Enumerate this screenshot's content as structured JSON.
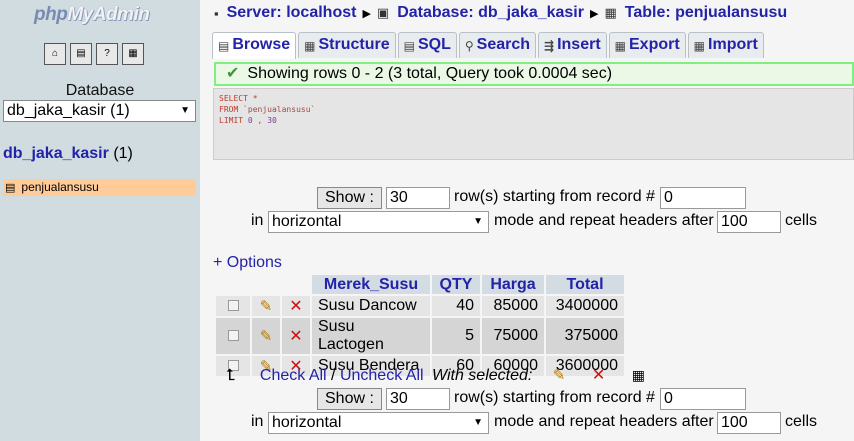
{
  "left": {
    "logo_php": "php",
    "logo_myadmin": "MyAdmin",
    "database_label": "Database",
    "database_select": "db_jaka_kasir (1)",
    "db_link": "db_jaka_kasir",
    "db_count": "(1)",
    "table_item": "penjualansusu"
  },
  "breadcrumb": {
    "server": "Server: localhost",
    "database": "Database: db_jaka_kasir",
    "table": "Table: penjualansusu"
  },
  "tabs": [
    {
      "label": "Browse",
      "icon": "browse-icon"
    },
    {
      "label": "Structure",
      "icon": "structure-icon"
    },
    {
      "label": "SQL",
      "icon": "sql-icon"
    },
    {
      "label": "Search",
      "icon": "search-icon"
    },
    {
      "label": "Insert",
      "icon": "insert-icon"
    },
    {
      "label": "Export",
      "icon": "export-icon"
    },
    {
      "label": "Import",
      "icon": "import-icon"
    }
  ],
  "notice": "Showing rows 0 - 2 (3 total, Query took 0.0004 sec)",
  "sql": {
    "line1_kw": "SELECT",
    "line1_rest": " *",
    "line2_kw": "FROM",
    "line2_str": " `penjualansusu`",
    "line3_kw": "LIMIT",
    "line3_n1": " 0",
    "line3_sep": " ,",
    "line3_n2": " 30"
  },
  "nav": {
    "show_button": "Show :",
    "rows_value": "30",
    "rows_text": "row(s) starting from record #",
    "start_value": "0",
    "in_text": "in",
    "mode_value": "horizontal",
    "repeat_text": "mode and repeat headers after",
    "repeat_value": "100",
    "cells_text": "cells"
  },
  "options_link": "+ Options",
  "table": {
    "headers": [
      "Merek_Susu",
      "QTY",
      "Harga",
      "Total"
    ],
    "rows": [
      [
        "Susu Dancow",
        "40",
        "85000",
        "3400000"
      ],
      [
        "Susu Lactogen",
        "5",
        "75000",
        "375000"
      ],
      [
        "Susu Bendera",
        "60",
        "60000",
        "3600000"
      ]
    ]
  },
  "checkall": {
    "check_all": "Check All",
    "slash": " / ",
    "uncheck_all": "Uncheck All",
    "with_selected": "With selected:"
  },
  "colors": {
    "link": "#2323a8",
    "left_bg": "#d0dce0",
    "selected_table_bg": "#ffcc99",
    "notice_border": "#7ff07f"
  }
}
